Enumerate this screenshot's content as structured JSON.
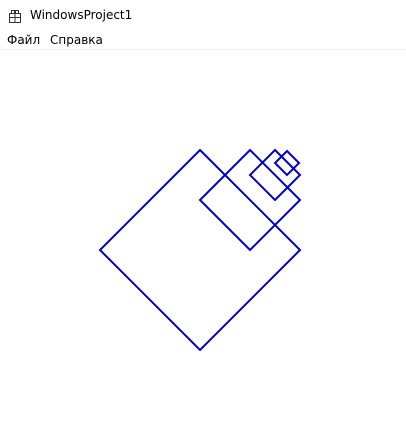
{
  "window": {
    "title": "WindowsProject1",
    "icon": "app-window-icon"
  },
  "menu": {
    "items": [
      {
        "label": "Файл"
      },
      {
        "label": "Справка"
      }
    ]
  },
  "drawing": {
    "stroke_color": "#0000cc",
    "background_color": "#ffffff",
    "shape": "nested-rotated-squares",
    "square_count": 4
  }
}
